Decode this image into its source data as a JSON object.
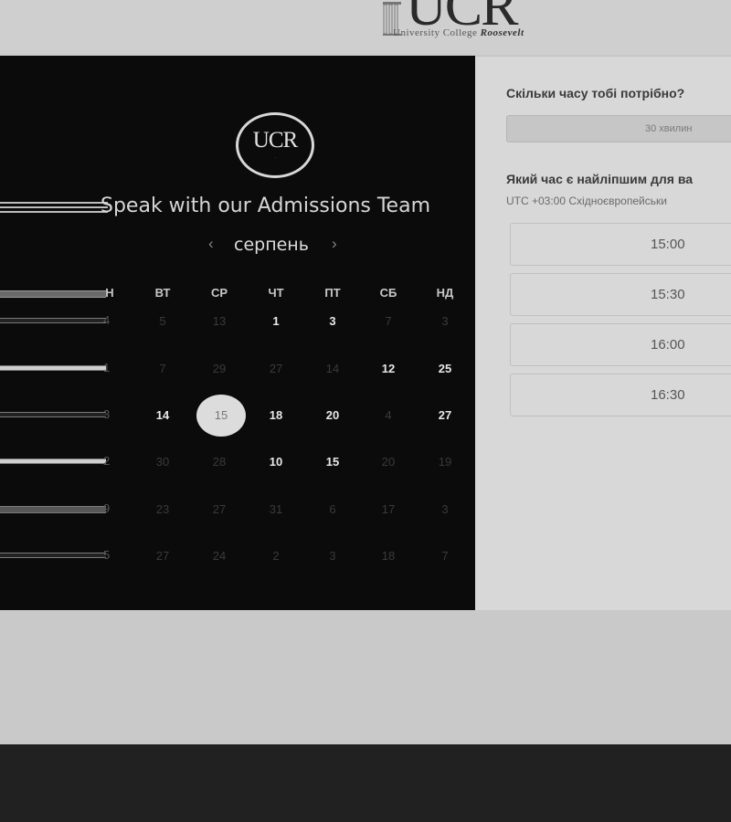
{
  "header": {
    "logo_letters": "UCR",
    "logo_subtitle": "University College",
    "logo_subtitle_brand": "Roosevelt"
  },
  "panel": {
    "seal_text": "UCR",
    "title": "Speak with our Admissions Team",
    "month": "серпень",
    "prev_icon": "‹",
    "next_icon": "›",
    "weekdays": [
      "Н",
      "ВТ",
      "СР",
      "ЧТ",
      "ПТ",
      "СБ",
      "НД"
    ],
    "rows": [
      {
        "first": "4",
        "days": [
          {
            "d": "5",
            "a": false
          },
          {
            "d": "13",
            "a": false
          },
          {
            "d": "1",
            "a": true
          },
          {
            "d": "3",
            "a": true
          },
          {
            "d": "7",
            "a": false
          },
          {
            "d": "3",
            "a": false
          }
        ]
      },
      {
        "first": "1",
        "days": [
          {
            "d": "7",
            "a": false
          },
          {
            "d": "29",
            "a": false
          },
          {
            "d": "27",
            "a": false
          },
          {
            "d": "14",
            "a": false
          },
          {
            "d": "12",
            "a": true
          },
          {
            "d": "25",
            "a": true
          }
        ]
      },
      {
        "first": "3",
        "days": [
          {
            "d": "14",
            "a": true
          },
          {
            "d": "15",
            "a": true,
            "sel": true
          },
          {
            "d": "18",
            "a": true
          },
          {
            "d": "20",
            "a": true
          },
          {
            "d": "4",
            "a": false
          },
          {
            "d": "27",
            "a": true
          }
        ]
      },
      {
        "first": "2",
        "days": [
          {
            "d": "30",
            "a": false
          },
          {
            "d": "28",
            "a": false
          },
          {
            "d": "10",
            "a": true
          },
          {
            "d": "15",
            "a": true
          },
          {
            "d": "20",
            "a": false
          },
          {
            "d": "19",
            "a": false
          }
        ]
      },
      {
        "first": "9",
        "days": [
          {
            "d": "23",
            "a": false
          },
          {
            "d": "27",
            "a": false
          },
          {
            "d": "31",
            "a": false
          },
          {
            "d": "6",
            "a": false
          },
          {
            "d": "17",
            "a": false
          },
          {
            "d": "3",
            "a": false
          }
        ]
      },
      {
        "first": "5",
        "days": [
          {
            "d": "27",
            "a": false
          },
          {
            "d": "24",
            "a": false
          },
          {
            "d": "2",
            "a": false
          },
          {
            "d": "3",
            "a": false
          },
          {
            "d": "18",
            "a": false
          },
          {
            "d": "7",
            "a": false
          }
        ]
      }
    ]
  },
  "booking": {
    "duration_question": "Скільки часу тобі потрібно?",
    "duration_value": "30 хвилин",
    "time_question": "Який час є найліпшим для ва",
    "timezone": "UTC +03:00 Східноєвропейськи",
    "slots": [
      "15:00",
      "15:30",
      "16:00",
      "16:30"
    ]
  }
}
